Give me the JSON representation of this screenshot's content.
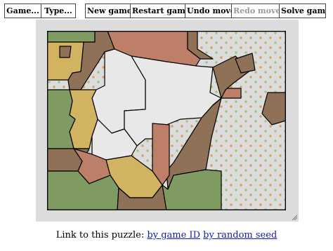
{
  "menu": {
    "game_label": "Game...",
    "type_label": "Type..."
  },
  "toolbar": {
    "new_game": "New game",
    "restart_game": "Restart game",
    "undo_move": "Undo move",
    "redo_move": "Redo move",
    "solve_game": "Solve game"
  },
  "footer": {
    "prefix": "Link to this puzzle:",
    "by_game_id": "by game ID",
    "by_random_seed": "by random seed"
  },
  "palette": {
    "green": "#7f9b62",
    "brown": "#8e7156",
    "terracotta": "#bd7f68",
    "ochre": "#d1b362",
    "blank": "#e8e8e8",
    "dotted_bg": "#ffffff",
    "dot_green": "#a8c07a",
    "dot_orange": "#d6a25a",
    "border": "#000000",
    "frame_bg": "#dcdcdc"
  }
}
